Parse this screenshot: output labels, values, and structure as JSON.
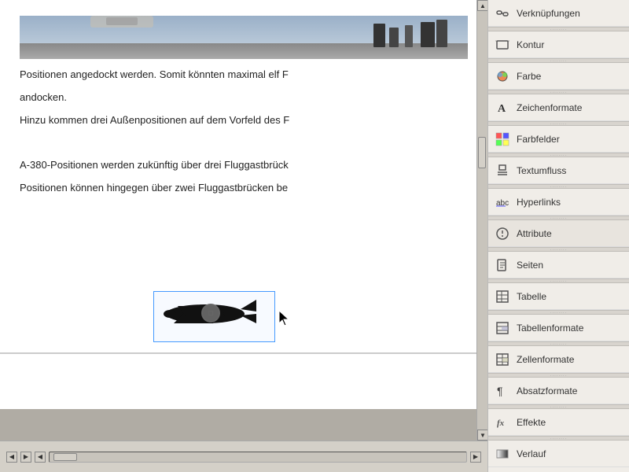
{
  "main": {
    "image_alt": "Airport tarmac photo",
    "paragraphs": [
      "Positionen angedockt werden. Somit könnten maximal elf F",
      "andocken.",
      "Hinzu kommen drei Außenpositionen auf dem Vorfeld des F",
      "",
      "A-380-Positionen werden zukünftig über drei Fluggastbrück",
      "Positionen können hingegen über zwei Fluggastbrücken be"
    ]
  },
  "sidebar": {
    "items": [
      {
        "id": "verknuepfungen",
        "label": "Verknüpfungen",
        "icon": "chain"
      },
      {
        "id": "kontur",
        "label": "Kontur",
        "icon": "contour"
      },
      {
        "id": "farbe",
        "label": "Farbe",
        "icon": "color"
      },
      {
        "id": "zeichenformate",
        "label": "Zeichenformate",
        "icon": "char"
      },
      {
        "id": "farbfelder",
        "label": "Farbfelder",
        "icon": "swatch"
      },
      {
        "id": "textumfluss",
        "label": "Textumfluss",
        "icon": "textflow"
      },
      {
        "id": "hyperlinks",
        "label": "Hyperlinks",
        "icon": "hyperlink"
      },
      {
        "id": "attribute",
        "label": "Attribute",
        "icon": "attr",
        "active": true
      },
      {
        "id": "seiten",
        "label": "Seiten",
        "icon": "pages"
      },
      {
        "id": "tabelle",
        "label": "Tabelle",
        "icon": "table"
      },
      {
        "id": "tabellenformate",
        "label": "Tabellenformate",
        "icon": "tablefmt"
      },
      {
        "id": "zellenformate",
        "label": "Zellenformate",
        "icon": "cellfmt"
      },
      {
        "id": "absatzformate",
        "label": "Absatzformate",
        "icon": "parafmt"
      },
      {
        "id": "effekte",
        "label": "Effekte",
        "icon": "effects"
      },
      {
        "id": "verlauf",
        "label": "Verlauf",
        "icon": "gradient"
      }
    ]
  },
  "scrollbar": {
    "up_arrow": "▲",
    "down_arrow": "▼",
    "left_arrow": "◀",
    "right_arrow": "▶"
  }
}
